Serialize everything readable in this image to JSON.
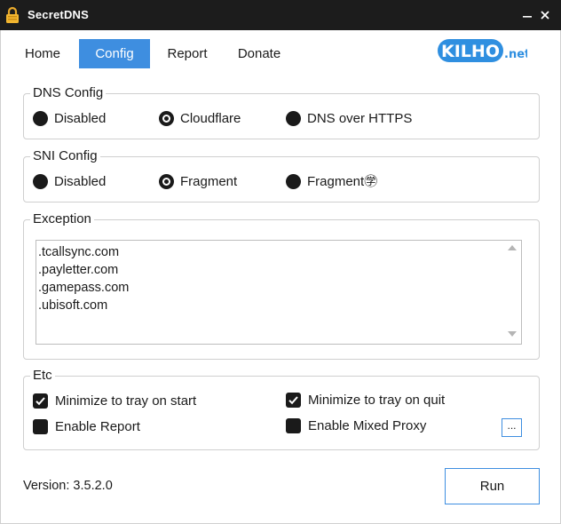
{
  "window": {
    "title": "SecretDNS"
  },
  "nav": {
    "home": "Home",
    "config": "Config",
    "report": "Report",
    "donate": "Donate"
  },
  "logo": {
    "text": "KILHO",
    "suffix": ".net"
  },
  "dns_config": {
    "label": "DNS Config",
    "options": [
      "Disabled",
      "Cloudflare",
      "DNS over HTTPS"
    ],
    "selected": "Cloudflare"
  },
  "sni_config": {
    "label": "SNI Config",
    "options": [
      "Disabled",
      "Fragment",
      "Fragment㊫"
    ],
    "selected": "Fragment"
  },
  "exception": {
    "label": "Exception",
    "entries": [
      ".tcallsync.com",
      ".payletter.com",
      ".gamepass.com",
      ".ubisoft.com"
    ]
  },
  "etc": {
    "label": "Etc",
    "minimize_start": {
      "label": "Minimize to tray on start",
      "checked": true
    },
    "minimize_quit": {
      "label": "Minimize to tray on quit",
      "checked": true
    },
    "enable_report": {
      "label": "Enable Report",
      "checked": false
    },
    "enable_mixed_proxy": {
      "label": "Enable Mixed Proxy",
      "checked": false
    },
    "more_button": "..."
  },
  "footer": {
    "version": "Version: 3.5.2.0",
    "run_button": "Run"
  },
  "colors": {
    "accent": "#3e8ee0",
    "titlebar": "#1c1c1c",
    "logo": "#2f8fe0"
  },
  "icons": {
    "app": "lock-icon",
    "minimize": "minimize-icon",
    "close": "close-icon"
  }
}
